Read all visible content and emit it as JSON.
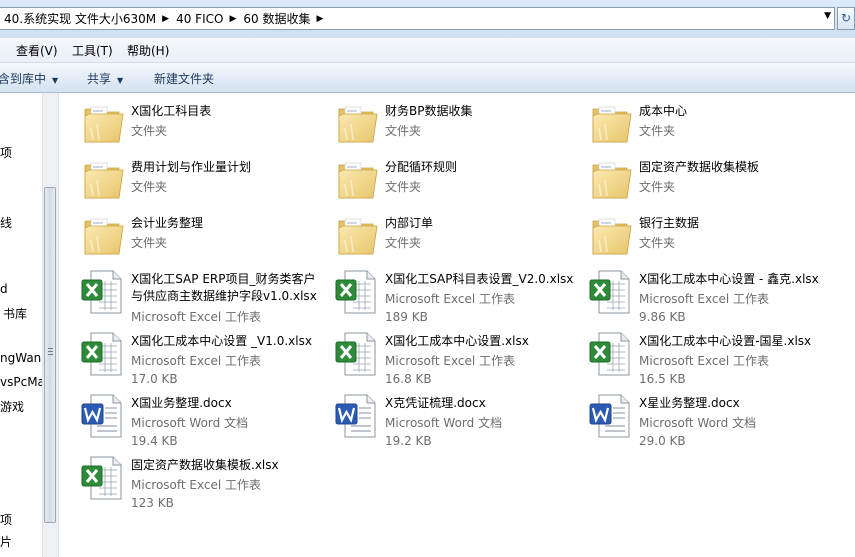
{
  "address_bar": {
    "crumbs": [
      "40.系统实现 文件大小630M",
      "40 FICO",
      "60 数据收集"
    ]
  },
  "menu": {
    "items": [
      "查看(V)",
      "工具(T)",
      "帮助(H)"
    ]
  },
  "commands": {
    "include_library": "含到库中",
    "share": "共享",
    "new_folder": "新建文件夹"
  },
  "nav_pane": {
    "items": [
      "项",
      "线",
      "d",
      "书库",
      "ngWan",
      "vsPcMa",
      "游戏",
      "项",
      "片"
    ]
  },
  "items": [
    {
      "name": "X国化工科目表",
      "type": "文件夹",
      "icon": "folder-icon"
    },
    {
      "name": "财务BP数据收集",
      "type": "文件夹",
      "icon": "folder-icon"
    },
    {
      "name": "成本中心",
      "type": "文件夹",
      "icon": "folder-icon"
    },
    {
      "name": "费用计划与作业量计划",
      "type": "文件夹",
      "icon": "folder-icon"
    },
    {
      "name": "分配循环规则",
      "type": "文件夹",
      "icon": "folder-icon"
    },
    {
      "name": "固定资产数据收集模板",
      "type": "文件夹",
      "icon": "folder-icon"
    },
    {
      "name": "会计业务整理",
      "type": "文件夹",
      "icon": "folder-icon"
    },
    {
      "name": "内部订单",
      "type": "文件夹",
      "icon": "folder-icon"
    },
    {
      "name": "银行主数据",
      "type": "文件夹",
      "icon": "folder-icon"
    },
    {
      "name": "X国化工SAP ERP项目_财务类客户与供应商主数据维护字段v1.0.xlsx",
      "type": "Microsoft Excel 工作表",
      "size": "",
      "icon": "excel-icon"
    },
    {
      "name": "X国化工SAP科目表设置_V2.0.xlsx",
      "type": "Microsoft Excel 工作表",
      "size": "189 KB",
      "icon": "excel-icon"
    },
    {
      "name": "X国化工成本中心设置 - 鑫克.xlsx",
      "type": "Microsoft Excel 工作表",
      "size": "9.86 KB",
      "icon": "excel-icon"
    },
    {
      "name": "X国化工成本中心设置 _V1.0.xlsx",
      "type": "Microsoft Excel 工作表",
      "size": "17.0 KB",
      "icon": "excel-icon"
    },
    {
      "name": "X国化工成本中心设置.xlsx",
      "type": "Microsoft Excel 工作表",
      "size": "16.8 KB",
      "icon": "excel-icon"
    },
    {
      "name": "X国化工成本中心设置-国星.xlsx",
      "type": "Microsoft Excel 工作表",
      "size": "16.5 KB",
      "icon": "excel-icon"
    },
    {
      "name": "X国业务整理.docx",
      "type": "Microsoft Word 文档",
      "size": "19.4 KB",
      "icon": "word-icon"
    },
    {
      "name": "X克凭证梳理.docx",
      "type": "Microsoft Word 文档",
      "size": "19.2 KB",
      "icon": "word-icon"
    },
    {
      "name": "X星业务整理.docx",
      "type": "Microsoft Word 文档",
      "size": "29.0 KB",
      "icon": "word-icon"
    },
    {
      "name": "固定资产数据收集模板.xlsx",
      "type": "Microsoft Excel 工作表",
      "size": "123 KB",
      "icon": "excel-icon"
    }
  ],
  "colors": {
    "folder": "#f3d88a",
    "excel": "#2e8b3a",
    "word": "#2b5bb5",
    "command_bar": "#dce7f4"
  }
}
